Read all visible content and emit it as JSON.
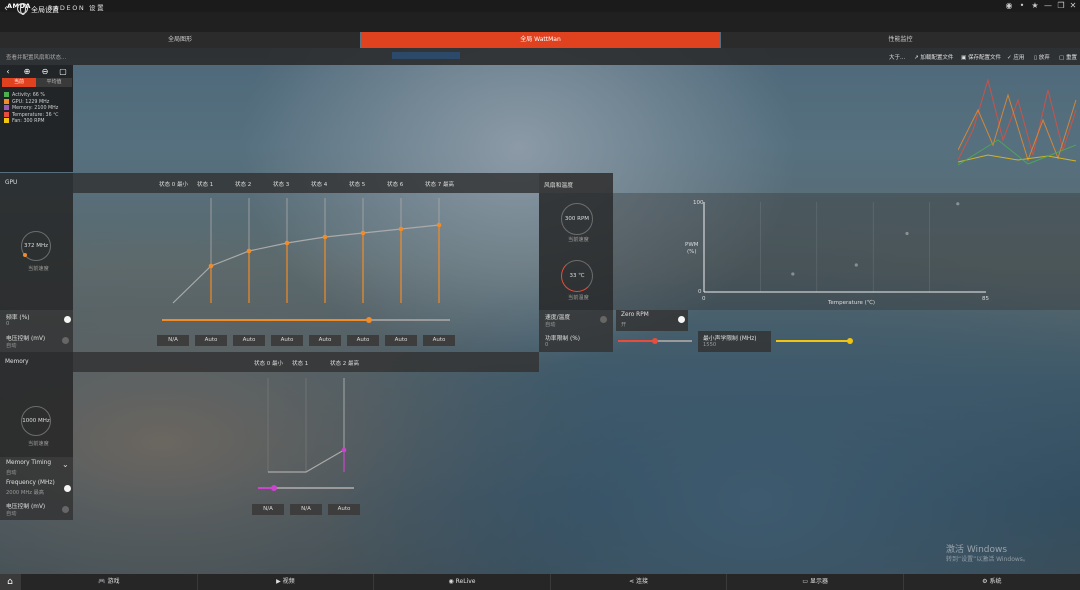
{
  "titlebar": {
    "logo": "AMDA",
    "app_title": "RADEON 设置",
    "buttons": [
      "◉",
      "•",
      "★",
      "—",
      "❐",
      "✕"
    ]
  },
  "header": {
    "title": "全局设置"
  },
  "tabs": [
    {
      "label": "全局图形",
      "active": false
    },
    {
      "label": "全局 WattMan",
      "active": true
    },
    {
      "label": "性能监控",
      "active": false
    }
  ],
  "subheader": {
    "hint": "查看并配置风扇和状态...",
    "actions": [
      "大于...",
      "加载配置文件",
      "保存配置文件",
      "应用",
      "放弃",
      "重置"
    ]
  },
  "monitor": {
    "tab_current": "当前",
    "tab_average": "平均值",
    "legend": [
      {
        "label": "Activity: 66 %",
        "color": "#4caf50"
      },
      {
        "label": "GPU: 1229 MHz",
        "color": "#f28c28"
      },
      {
        "label": "Memory: 2100 MHz",
        "color": "#9b59b6"
      },
      {
        "label": "Temperature: 36 ℃",
        "color": "#e74c3c"
      },
      {
        "label": "Fan: 300 RPM",
        "color": "#f1c40f"
      }
    ]
  },
  "gpu": {
    "title": "GPU",
    "states": [
      "状态 0 最小",
      "状态 1",
      "状态 2",
      "状态 3",
      "状态 4",
      "状态 5",
      "状态 6",
      "状态 7 最高"
    ],
    "gauge_value": "372 MHz",
    "gauge_label": "当前速度",
    "freq_label": "频率 (%)",
    "freq_value": "0",
    "freq_slider_level": 0.72,
    "voltage_label": "电压控制 (mV)",
    "voltage_value": "自动",
    "voltage_buttons": [
      "N/A",
      "Auto",
      "Auto",
      "Auto",
      "Auto",
      "Auto",
      "Auto",
      "Auto"
    ],
    "curve": [
      0.0,
      0.37,
      0.52,
      0.6,
      0.66,
      0.7,
      0.74,
      0.78
    ]
  },
  "memory": {
    "title": "Memory",
    "states": [
      "状态 0 最小",
      "状态 1",
      "状态 2 最高"
    ],
    "gauge_value": "1000 MHz",
    "gauge_label": "当前速度",
    "timing_label": "Memory Timing",
    "timing_value": "自动",
    "freq_label": "Frequency (MHz)",
    "freq_value": "2000 MHz 最高",
    "freq_slider_level": 0.17,
    "voltage_label": "电压控制 (mV)",
    "voltage_value": "自动",
    "voltage_buttons": [
      "N/A",
      "N/A",
      "Auto"
    ],
    "curve": [
      0.0,
      0.0,
      0.22
    ]
  },
  "fan": {
    "title": "风扇和温度",
    "rpm_value": "300 RPM",
    "rpm_label": "当前速度",
    "temp_value": "33 ℃",
    "temp_label": "当前温度",
    "speed_temp_label": "速度/温度",
    "speed_temp_value": "自动",
    "zero_rpm_label": "Zero RPM",
    "zero_rpm_value": "开",
    "power_label": "功率限制 (%)",
    "power_value": "0",
    "power_slider_level": 0.5,
    "min_acoustic_label": "最小声学限制 (MHz)",
    "min_acoustic_value": "1550",
    "min_acoustic_slider_level": 1.0,
    "chart": {
      "y_top": "100",
      "y_bottom": "0",
      "y_label": "PWM",
      "y_unit": "(%)",
      "x_left": "0",
      "x_right": "85",
      "x_label": "Temperature (℃)"
    }
  },
  "nav": [
    {
      "icon": "🎮",
      "label": "游戏"
    },
    {
      "icon": "▶",
      "label": "视频"
    },
    {
      "icon": "◉",
      "label": "ReLive"
    },
    {
      "icon": "⋖",
      "label": "连接"
    },
    {
      "icon": "▭",
      "label": "显示器"
    },
    {
      "icon": "⚙",
      "label": "系统"
    }
  ],
  "watermark": {
    "line1": "激活 Windows",
    "line2": "转到“设置”以激活 Windows。"
  },
  "colors": {
    "accent": "#e0411e",
    "gpu_orange": "#f28c28",
    "mem_magenta": "#cc44cc",
    "fan_red": "#e74c3c",
    "acoustic_yellow": "#f1c40f"
  }
}
